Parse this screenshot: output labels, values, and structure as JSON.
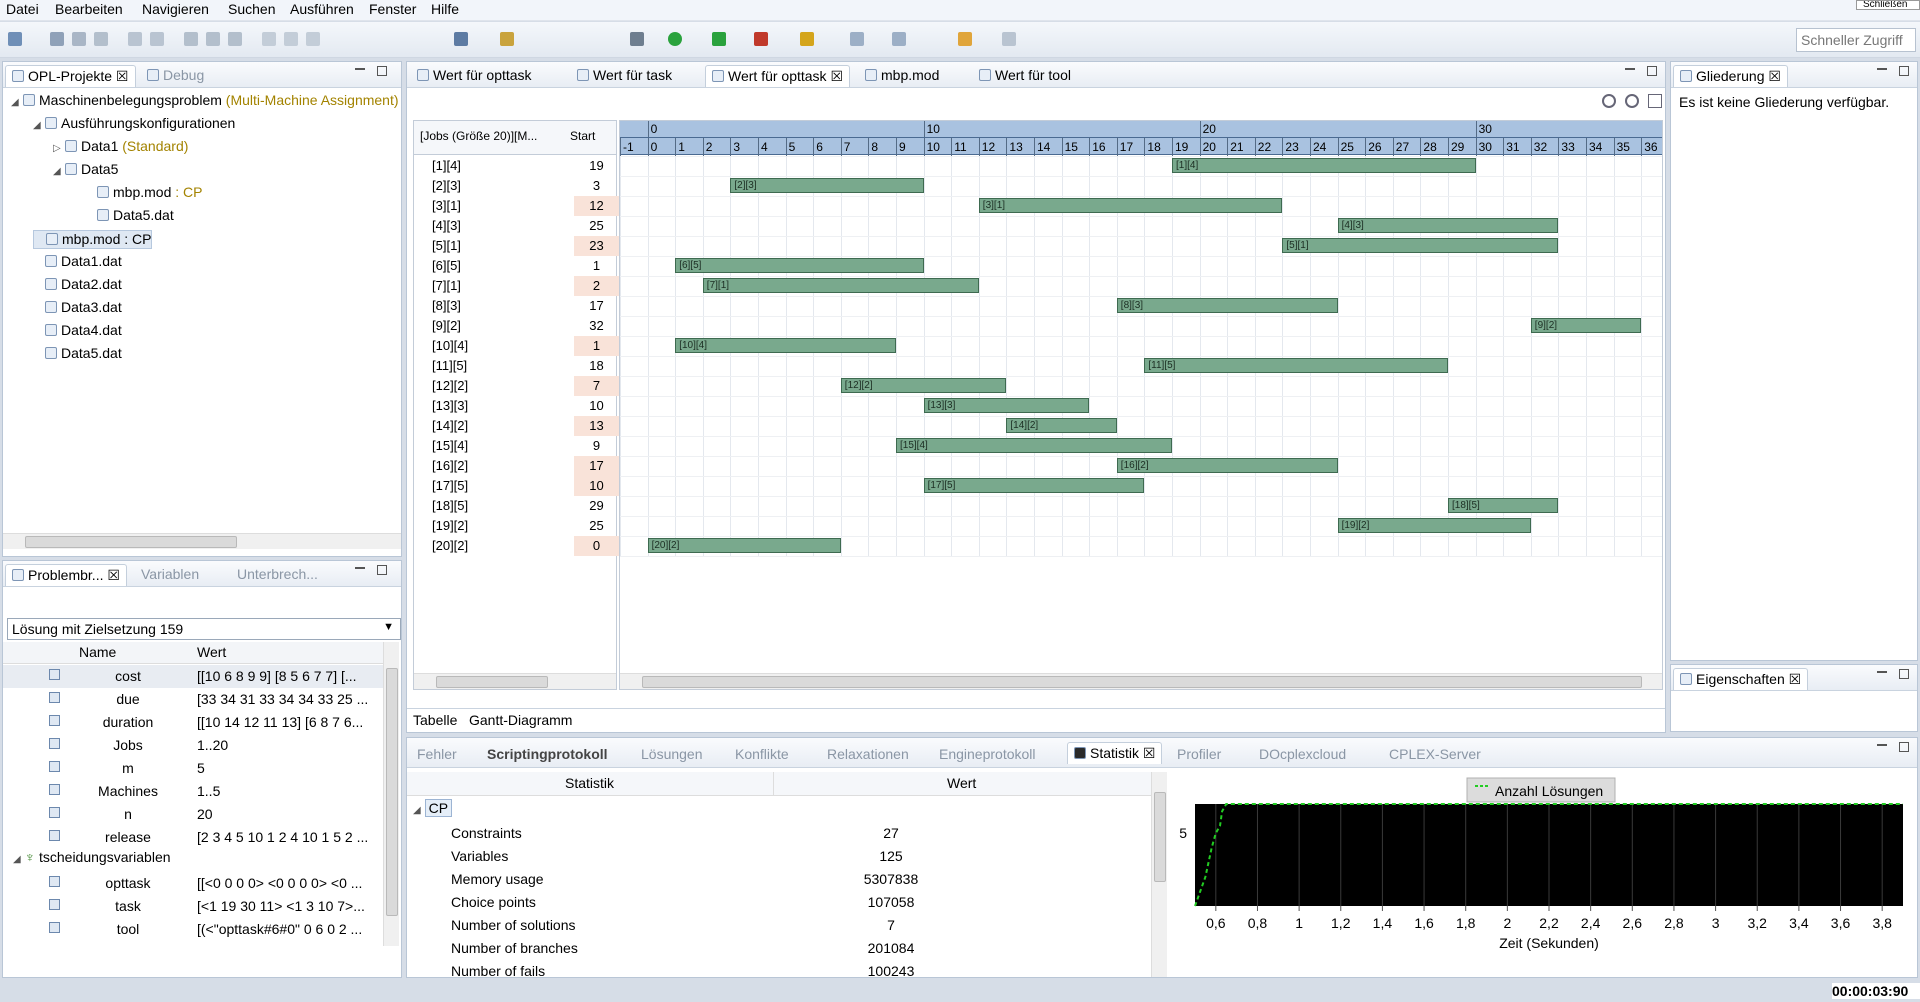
{
  "menu": [
    "Datei",
    "Bearbeiten",
    "Navigieren",
    "Suchen",
    "Ausführen",
    "Fenster",
    "Hilfe"
  ],
  "toolbar": {
    "quick_access": "Schneller Zugriff",
    "corner": "Schließen"
  },
  "projects": {
    "tab_active": "OPL-Projekte",
    "tab_other": "Debug",
    "tree": [
      {
        "label": "Maschinenbelegungsproblem",
        "suffix": "(Multi-Machine Assignment)",
        "level": 0,
        "arrow": "◢"
      },
      {
        "label": "Ausführungskonfigurationen",
        "suffix": "",
        "level": 1,
        "arrow": "◢"
      },
      {
        "label": "Data1",
        "suffix": "(Standard)",
        "level": 2,
        "arrow": "▷"
      },
      {
        "label": "Data5",
        "suffix": "",
        "level": 2,
        "arrow": "◢"
      },
      {
        "label": "mbp.mod",
        "suffix": ": CP",
        "level": 3,
        "arrow": ""
      },
      {
        "label": "Data5.dat",
        "suffix": "",
        "level": 3,
        "arrow": ""
      },
      {
        "label": "mbp.mod : CP",
        "suffix": "",
        "level": 1,
        "arrow": ""
      },
      {
        "label": "Data1.dat",
        "suffix": "",
        "level": 1,
        "arrow": ""
      },
      {
        "label": "Data2.dat",
        "suffix": "",
        "level": 1,
        "arrow": ""
      },
      {
        "label": "Data3.dat",
        "suffix": "",
        "level": 1,
        "arrow": ""
      },
      {
        "label": "Data4.dat",
        "suffix": "",
        "level": 1,
        "arrow": ""
      },
      {
        "label": "Data5.dat",
        "suffix": "",
        "level": 1,
        "arrow": ""
      }
    ]
  },
  "problem": {
    "tabs": [
      "Problembr...",
      "Variablen",
      "Unterbrech..."
    ],
    "solution_select": "Lösung mit Zielsetzung 159",
    "col_name": "Name",
    "col_value": "Wert",
    "rows": [
      {
        "name": "cost",
        "value": "[[10 6 8 9 9]  [8 5 6 7 7]  [..."
      },
      {
        "name": "due",
        "value": "[33 34 31 33 34 34 33 25 ..."
      },
      {
        "name": "duration",
        "value": "[[10 14 12 11 13]  [6 8 7 6..."
      },
      {
        "name": "Jobs",
        "value": "1..20"
      },
      {
        "name": "m",
        "value": "5"
      },
      {
        "name": "Machines",
        "value": "1..5"
      },
      {
        "name": "n",
        "value": "20"
      },
      {
        "name": "release",
        "value": "[2 3 4 5 10 1 2 4 10 1 5 2 ..."
      }
    ],
    "group": "tscheidungsvariablen",
    "dvars": [
      {
        "name": "opttask",
        "value": "[[<0 0 0 0>  <0 0 0 0>  <0 ..."
      },
      {
        "name": "task",
        "value": "[<1 19 30 11>  <1 3 10 7>..."
      },
      {
        "name": "tool",
        "value": "[(<\"opttask#6#0\" 0 6 0 2 ..."
      }
    ]
  },
  "editor": {
    "tabs": [
      "Wert für opttask",
      "Wert für task",
      "Wert für opttask",
      "mbp.mod",
      "Wert für tool"
    ],
    "col_jobs": "[Jobs (Größe 20)][M...",
    "col_start": "Start",
    "major_ticks": [
      "0",
      "10",
      "20",
      "30"
    ],
    "minor_ticks": [
      "-1",
      "0",
      "1",
      "2",
      "3",
      "4",
      "5",
      "6",
      "7",
      "8",
      "9",
      "10",
      "11",
      "12",
      "13",
      "14",
      "15",
      "16",
      "17",
      "18",
      "19",
      "20",
      "21",
      "22",
      "23",
      "24",
      "25",
      "26",
      "27",
      "28",
      "29",
      "30",
      "31",
      "32",
      "33",
      "34",
      "35",
      "36"
    ],
    "bottom_tabs": [
      "Tabelle",
      "Gantt-Diagramm"
    ]
  },
  "gantt": {
    "jobs": [
      {
        "label": "[1][4]",
        "start": 19,
        "end": 30
      },
      {
        "label": "[2][3]",
        "start": 3,
        "end": 10
      },
      {
        "label": "[3][1]",
        "start": 12,
        "end": 23
      },
      {
        "label": "[4][3]",
        "start": 25,
        "end": 33
      },
      {
        "label": "[5][1]",
        "start": 23,
        "end": 33
      },
      {
        "label": "[6][5]",
        "start": 1,
        "end": 10
      },
      {
        "label": "[7][1]",
        "start": 2,
        "end": 12
      },
      {
        "label": "[8][3]",
        "start": 17,
        "end": 25
      },
      {
        "label": "[9][2]",
        "start": 32,
        "end": 36
      },
      {
        "label": "[10][4]",
        "start": 1,
        "end": 9
      },
      {
        "label": "[11][5]",
        "start": 18,
        "end": 29
      },
      {
        "label": "[12][2]",
        "start": 7,
        "end": 13
      },
      {
        "label": "[13][3]",
        "start": 10,
        "end": 16
      },
      {
        "label": "[14][2]",
        "start": 13,
        "end": 17
      },
      {
        "label": "[15][4]",
        "start": 9,
        "end": 19
      },
      {
        "label": "[16][2]",
        "start": 17,
        "end": 25
      },
      {
        "label": "[17][5]",
        "start": 10,
        "end": 18
      },
      {
        "label": "[18][5]",
        "start": 29,
        "end": 33
      },
      {
        "label": "[19][2]",
        "start": 25,
        "end": 32
      },
      {
        "label": "[20][2]",
        "start": 0,
        "end": 7
      }
    ],
    "row_labels": [
      "[1][4]",
      "[2][3]",
      "[3][1]",
      "[4][3]",
      "[5][1]",
      "[6][5]",
      "[7][1]",
      "[8][3]",
      "[9][2]",
      "[10][4]",
      "[11][5]",
      "[12][2]",
      "[13][3]",
      "[14][2]",
      "[15][4]",
      "[16][2]",
      "[17][5]",
      "[18][5]",
      "[19][2]",
      "[20][2]"
    ],
    "start_values": [
      "19",
      "3",
      "12",
      "25",
      "23",
      "1",
      "2",
      "17",
      "32",
      "1",
      "18",
      "7",
      "10",
      "13",
      "9",
      "17",
      "10",
      "29",
      "25",
      "0"
    ]
  },
  "outline": {
    "tab": "Gliederung",
    "message": "Es ist keine Gliederung verfügbar.",
    "props_tab": "Eigenschaften"
  },
  "console": {
    "tabs": [
      "Fehler",
      "Scriptingprotokoll",
      "Lösungen",
      "Konflikte",
      "Relaxationen",
      "Engineprotokoll",
      "Statistik",
      "Profiler",
      "DOcplexcloud",
      "CPLEX-Server"
    ],
    "col_stat": "Statistik",
    "col_value": "Wert",
    "group": "CP",
    "rows": [
      {
        "name": "Constraints",
        "value": "27"
      },
      {
        "name": "Variables",
        "value": "125"
      },
      {
        "name": "Memory usage",
        "value": "5307838"
      },
      {
        "name": "Choice points",
        "value": "107058"
      },
      {
        "name": "Number of solutions",
        "value": "7"
      },
      {
        "name": "Number of branches",
        "value": "201084"
      },
      {
        "name": "Number of fails",
        "value": "100243"
      }
    ]
  },
  "chart_data": {
    "type": "line",
    "legend": "Anzahl Lösungen",
    "xlabel": "Zeit (Sekunden)",
    "x_ticks": [
      "0,6",
      "0,8",
      "1",
      "1,2",
      "1,4",
      "1,6",
      "1,8",
      "2",
      "2,2",
      "2,4",
      "2,6",
      "2,8",
      "3",
      "3,2",
      "3,4",
      "3,6",
      "3,8"
    ],
    "y_ticks": [
      "5"
    ],
    "xlim": [
      0.5,
      3.9
    ],
    "ylim": [
      0,
      7
    ],
    "series": [
      {
        "name": "Anzahl Lösungen",
        "x": [
          0.5,
          0.55,
          0.58,
          0.6,
          0.62,
          0.63,
          0.65,
          3.9
        ],
        "y": [
          0,
          2,
          4,
          5,
          5.5,
          6.5,
          7,
          7
        ],
        "color": "#22cc22"
      }
    ]
  },
  "status": {
    "timer": "00:00:03:90"
  },
  "colors": {
    "bar": "#79a98d",
    "ganttHeader": "#a9c2e0",
    "chartBg": "#000000",
    "highlight": "#f9e3d9"
  }
}
